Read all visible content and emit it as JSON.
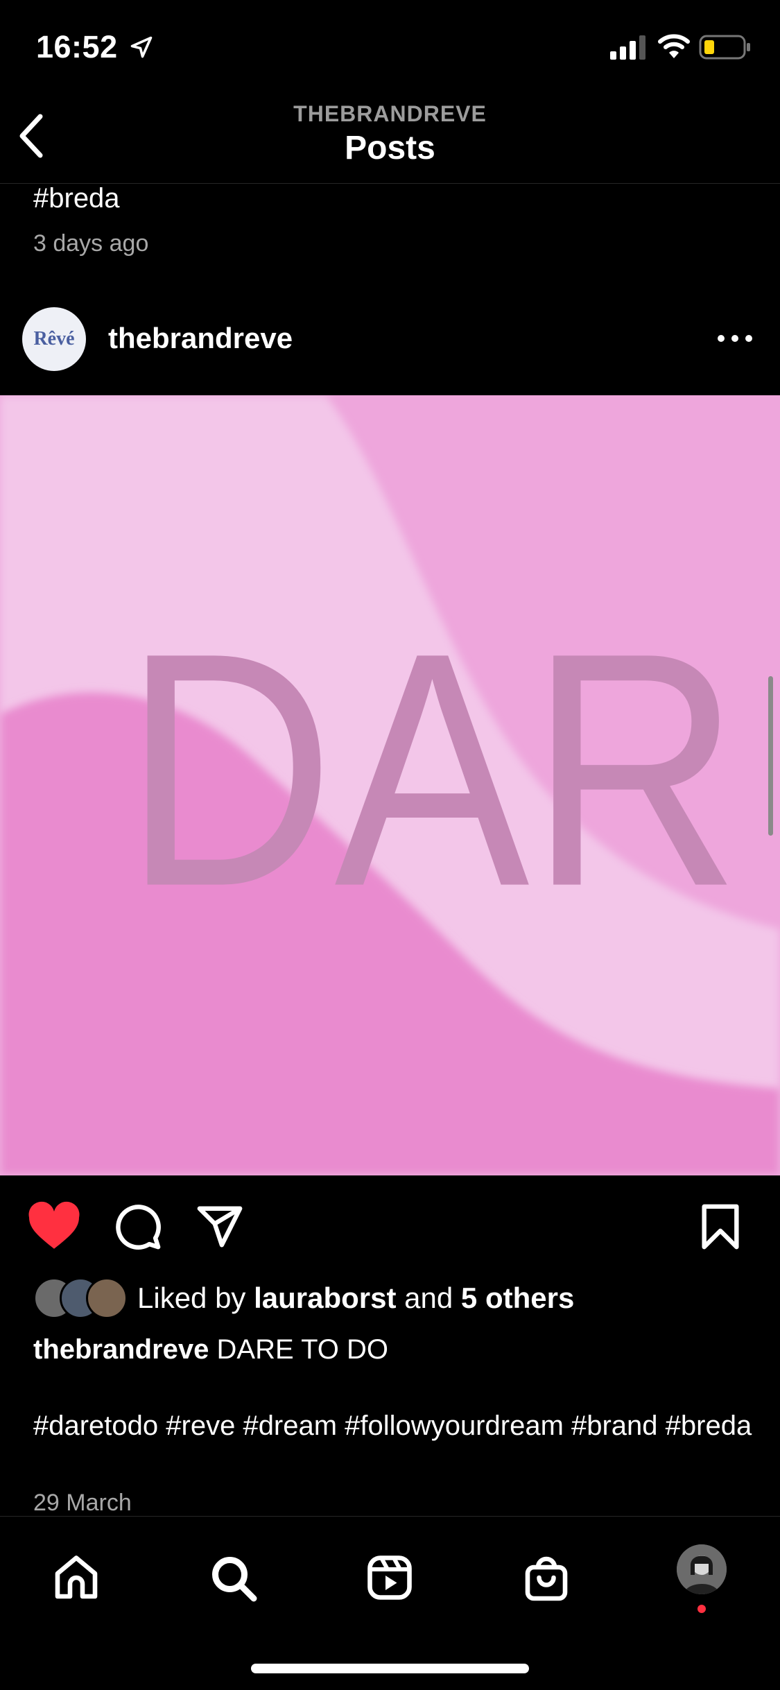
{
  "status": {
    "time": "16:52"
  },
  "header": {
    "account": "THEBRANDREVE",
    "title": "Posts"
  },
  "previous_post": {
    "caption_tail": "#breda",
    "date": "3 days ago"
  },
  "post": {
    "avatar_text": "Rêvé",
    "username": "thebrandreve",
    "image_text": "DAR",
    "likes": {
      "prefix": "Liked by",
      "user": "lauraborst",
      "middle": "and",
      "others": "5 others"
    },
    "caption": {
      "user": "thebrandreve",
      "text": "DARE TO DO"
    },
    "hashtags": "#daretodo #reve #dream #followyourdream #brand #breda",
    "date": "29 March"
  },
  "colors": {
    "like_active": "#ff3040",
    "image_light_pink": "#f3c6e9",
    "image_mid_pink": "#eea6dc",
    "image_deep_pink": "#e98bcf",
    "image_text": "#c688b6"
  },
  "icons": {
    "back": "chevron-left-icon",
    "more": "more-horizontal-icon",
    "like": "heart-filled-icon",
    "comment": "comment-icon",
    "share": "paper-plane-icon",
    "save": "bookmark-icon",
    "home": "home-icon",
    "search": "search-icon",
    "reels": "reels-icon",
    "shop": "shopping-bag-icon"
  }
}
